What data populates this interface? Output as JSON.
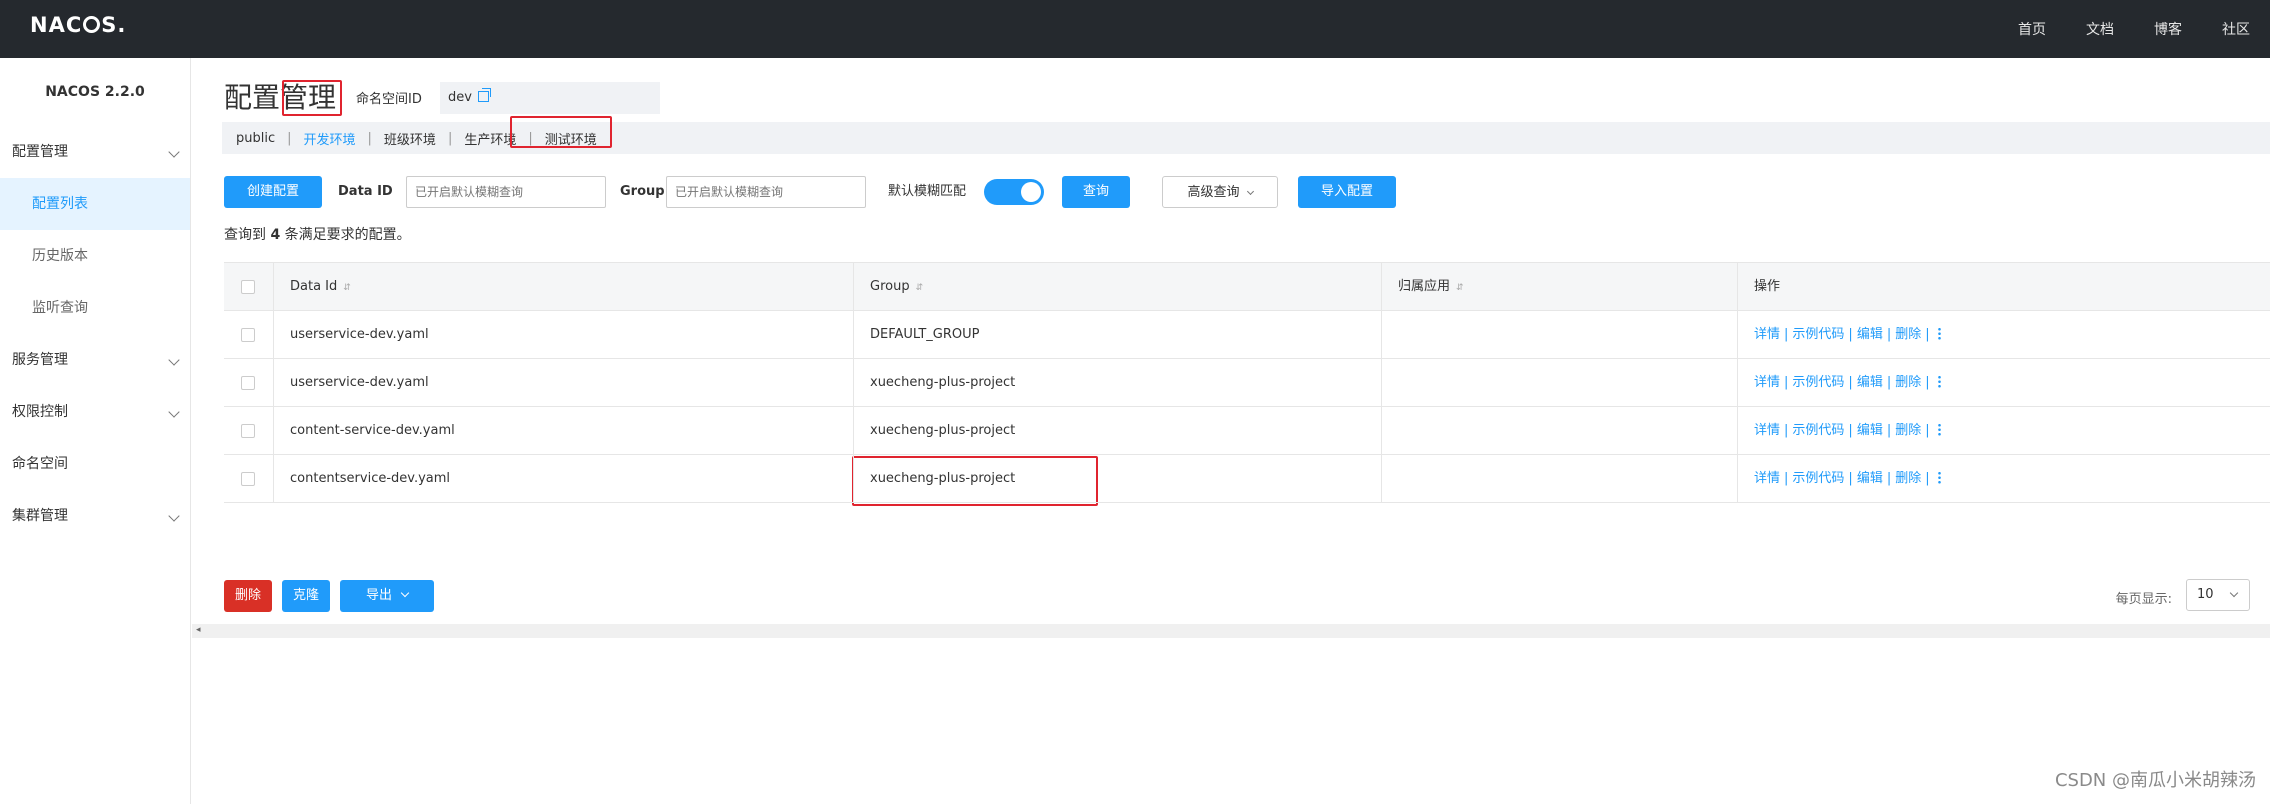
{
  "topbar": {
    "logo": "NACOS.",
    "nav": [
      "首页",
      "文档",
      "博客",
      "社区"
    ]
  },
  "sidebar": {
    "version": "NACOS 2.2.0",
    "items": [
      {
        "label": "配置管理",
        "expandable": true
      },
      {
        "label": "配置列表",
        "sub": true,
        "active": true
      },
      {
        "label": "历史版本",
        "sub": true
      },
      {
        "label": "监听查询",
        "sub": true
      },
      {
        "label": "服务管理",
        "expandable": true
      },
      {
        "label": "权限控制",
        "expandable": true
      },
      {
        "label": "命名空间"
      },
      {
        "label": "集群管理",
        "expandable": true
      }
    ]
  },
  "page": {
    "title": "配置管理",
    "namespace_label": "命名空间ID",
    "namespace_value": "dev"
  },
  "namespaces": [
    "public",
    "开发环境",
    "班级环境",
    "生产环境",
    "测试环境"
  ],
  "active_namespace": "开发环境",
  "filter": {
    "create_label": "创建配置",
    "dataid_label": "Data ID",
    "dataid_placeholder": "已开启默认模糊查询",
    "group_label": "Group",
    "group_placeholder": "已开启默认模糊查询",
    "fuzzy_label": "默认模糊匹配",
    "fuzzy_on": true,
    "query_label": "查询",
    "advanced_label": "高级查询",
    "import_label": "导入配置"
  },
  "result": {
    "prefix": "查询到",
    "count": "4",
    "suffix": "条满足要求的配置。"
  },
  "table": {
    "headers": [
      "Data Id",
      "Group",
      "归属应用",
      "操作"
    ],
    "rows": [
      {
        "dataid": "userservice-dev.yaml",
        "group": "DEFAULT_GROUP",
        "app": ""
      },
      {
        "dataid": "userservice-dev.yaml",
        "group": "xuecheng-plus-project",
        "app": ""
      },
      {
        "dataid": "content-service-dev.yaml",
        "group": "xuecheng-plus-project",
        "app": ""
      },
      {
        "dataid": "contentservice-dev.yaml",
        "group": "xuecheng-plus-project",
        "app": ""
      }
    ],
    "ops": [
      "详情",
      "示例代码",
      "编辑",
      "删除"
    ]
  },
  "bottom": {
    "delete_label": "删除",
    "clone_label": "克隆",
    "export_label": "导出",
    "pagesize_label": "每页显示:",
    "pagesize_value": "10"
  },
  "watermark": "CSDN @南瓜小米胡辣汤",
  "colors": {
    "accent": "#209bfa",
    "danger": "#d93026",
    "annotation": "#e0242f",
    "topbar": "#25292e"
  }
}
